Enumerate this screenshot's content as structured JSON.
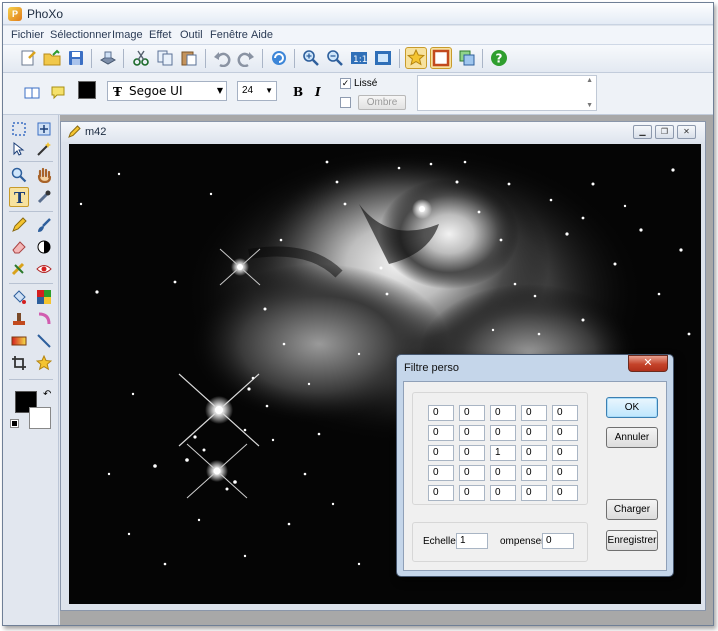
{
  "app": {
    "title": "PhoXo"
  },
  "menu": [
    "Fichier",
    "Sélectionner",
    "Image",
    "Effet",
    "Outil",
    "Fenêtre",
    "Aide"
  ],
  "format_bar": {
    "font": "Segoe UI",
    "size": "24",
    "bold_label": "B",
    "italic_label": "I",
    "smooth_label": "Lissé",
    "smooth_checked": "✓",
    "shadow_button": "Ombre",
    "text_color": "#000000"
  },
  "document": {
    "title": "m42"
  },
  "dialog": {
    "title": "Filtre perso",
    "close": "✕",
    "matrix": [
      [
        "0",
        "0",
        "0",
        "0",
        "0"
      ],
      [
        "0",
        "0",
        "0",
        "0",
        "0"
      ],
      [
        "0",
        "0",
        "1",
        "0",
        "0"
      ],
      [
        "0",
        "0",
        "0",
        "0",
        "0"
      ],
      [
        "0",
        "0",
        "0",
        "0",
        "0"
      ]
    ],
    "scale_label": "Echelle",
    "scale_value": "1",
    "offset_label": "ompenser",
    "offset_value": "0",
    "ok": "OK",
    "cancel": "Annuler",
    "load": "Charger",
    "save": "Enregistrer"
  }
}
